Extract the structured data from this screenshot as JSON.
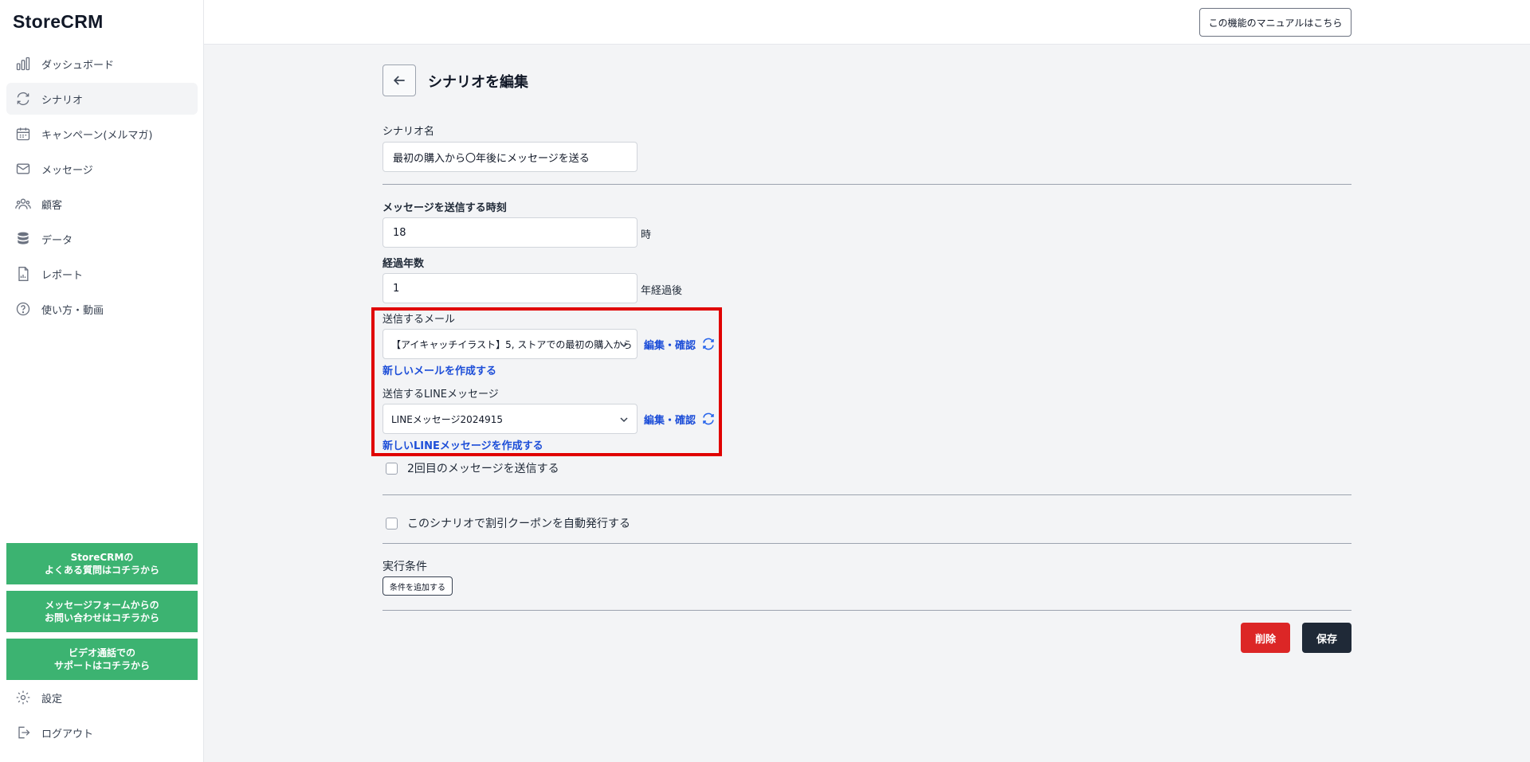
{
  "app": {
    "logo": "StoreCRM"
  },
  "sidebar": {
    "items": [
      {
        "label": "ダッシュボード",
        "icon": "bar-chart-icon"
      },
      {
        "label": "シナリオ",
        "icon": "refresh-icon"
      },
      {
        "label": "キャンペーン(メルマガ)",
        "icon": "calendar-icon"
      },
      {
        "label": "メッセージ",
        "icon": "mail-icon"
      },
      {
        "label": "顧客",
        "icon": "users-icon"
      },
      {
        "label": "データ",
        "icon": "database-icon"
      },
      {
        "label": "レポート",
        "icon": "report-icon"
      },
      {
        "label": "使い方・動画",
        "icon": "help-icon"
      }
    ],
    "support": [
      {
        "label": "StoreCRMの\nよくある質問はコチラから"
      },
      {
        "label": "メッセージフォームからの\nお問い合わせはコチラから"
      },
      {
        "label": "ビデオ通話での\nサポートはコチラから"
      }
    ],
    "bottom": [
      {
        "label": "設定",
        "icon": "gear-icon"
      },
      {
        "label": "ログアウト",
        "icon": "logout-icon"
      }
    ],
    "accent_color": "#3cb371"
  },
  "header": {
    "manual_label": "この機能のマニュアルはこちら"
  },
  "page": {
    "title": "シナリオを編集"
  },
  "form": {
    "scenario_name_label": "シナリオ名",
    "scenario_name_value": "最初の購入から〇年後にメッセージを送る",
    "send_time_label": "メッセージを送信する時刻",
    "send_time_value": "18",
    "send_time_suffix": "時",
    "years_label": "経過年数",
    "years_value": "1",
    "years_suffix": "年経過後",
    "mail_label": "送信するメール",
    "mail_selected": "【アイキャッチイラスト】5, ストアでの最初の購入から",
    "mail_edit": "編集・確認",
    "mail_new": "新しいメールを作成する",
    "line_label": "送信するLINEメッセージ",
    "line_selected": "LINEメッセージ2024915",
    "line_edit": "編集・確認",
    "line_new": "新しいLINEメッセージを作成する",
    "second_msg_label": "2回目のメッセージを送信する",
    "coupon_label": "このシナリオで割引クーポンを自動発行する",
    "conditions_label": "実行条件",
    "add_condition": "条件を追加する",
    "delete": "削除",
    "save": "保存"
  },
  "colors": {
    "highlight": "#e00000",
    "link": "#1d4ed8",
    "delete": "#dc2626",
    "save": "#1f2937"
  }
}
